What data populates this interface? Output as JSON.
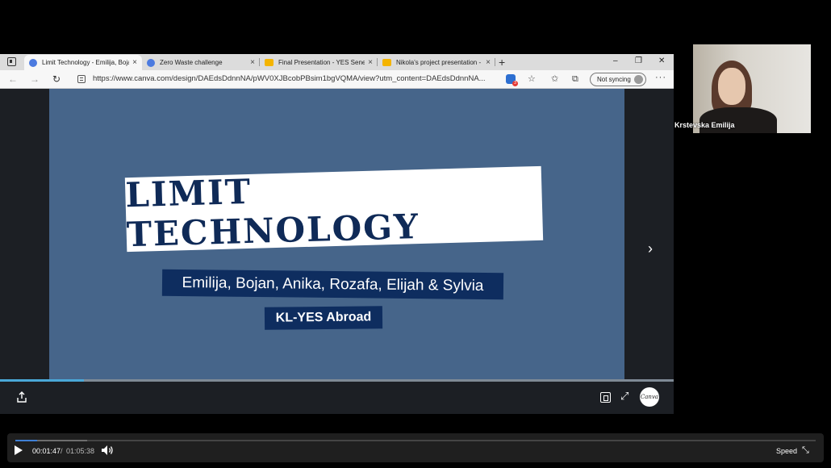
{
  "browser": {
    "tabs": [
      {
        "label": "Limit Technology - Emilija, Bojan",
        "icon": "canva-icon",
        "active": true
      },
      {
        "label": "Zero Waste challenge",
        "icon": "canva-icon",
        "active": false
      },
      {
        "label": "Final Presentation - YES Senegal",
        "icon": "slides-icon",
        "active": false
      },
      {
        "label": "Nikola's project presentation - G",
        "icon": "slides-icon",
        "active": false
      }
    ],
    "tab_close": "×",
    "new_tab": "+",
    "window": {
      "minimize": "–",
      "restore": "❐",
      "close": "✕"
    },
    "nav": {
      "back": "←",
      "forward": "→",
      "refresh": "↻"
    },
    "url": "https://www.canva.com/design/DAEdsDdnnNA/pWV0XJBcobPBsim1bgVQMA/view?utm_content=DAEdsDdnnNA...",
    "toolbar": {
      "favorites_add": "☆",
      "favorites": "✩",
      "collections": "⧉",
      "more": "···"
    },
    "sync_label": "Not syncing",
    "extension_badge": "3"
  },
  "slide": {
    "title": "LIMIT TECHNOLOGY",
    "names": "Emilija, Bojan, Anika, Rozafa, Elijah & Sylvia",
    "org": "KL-YES Abroad",
    "next_arrow": "›",
    "progress_fraction": 0.125
  },
  "canva": {
    "logo_text": "Canva",
    "expand": "⤢"
  },
  "participant": {
    "name": "Krstevska Emilija"
  },
  "player": {
    "current_time": "00:01:47",
    "separator": "/",
    "total_time": "01:05:38",
    "progress_fraction": 0.027,
    "buffer_fraction": 0.09,
    "speed_label": "Speed",
    "fullscreen_glyph": "⤡"
  },
  "colors": {
    "slide_bg": "#46658a",
    "navy": "#0e2d5f",
    "accent": "#3f7fd4"
  }
}
